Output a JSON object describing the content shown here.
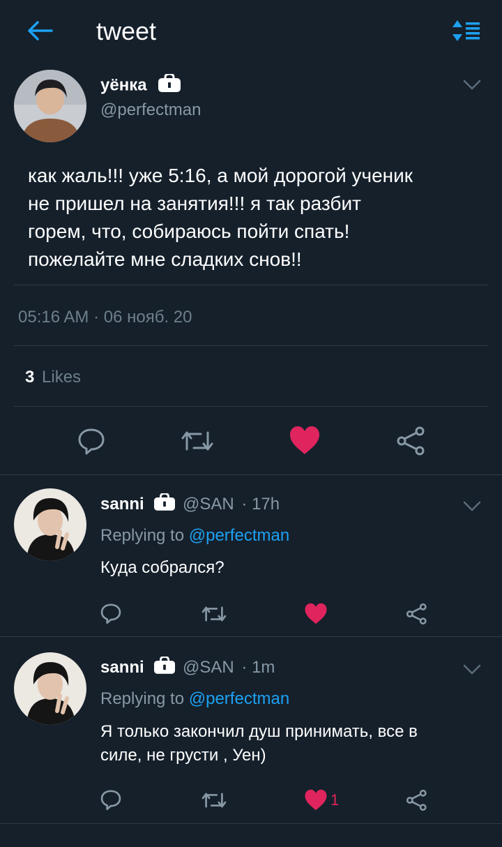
{
  "header": {
    "title": "tweet",
    "back_icon": "arrow-left-icon",
    "sort_icon": "sort-icon",
    "accent": "#1da1f2"
  },
  "main_tweet": {
    "display_name": "уёнка",
    "handle": "@perfectman",
    "text_lines": [
      "как жаль!!! уже 5:16, а мой дорогой ученик",
      "не пришел на занятия!!! я так разбит",
      "горем, что, собираюсь пойти спать!",
      "пожелайте мне сладких снов!!"
    ],
    "timestamp": "05:16 AM · 06 нояб. 20",
    "likes_count": "3",
    "likes_label": "Likes",
    "liked": true
  },
  "replies": [
    {
      "display_name": "sanni",
      "handle": "@SAN",
      "time": "· 17h",
      "replying_to_label": "Replying to",
      "replying_to_handle": "@perfectman",
      "text_lines": [
        "Куда собрался?"
      ],
      "liked": true,
      "like_count": ""
    },
    {
      "display_name": "sanni",
      "handle": "@SAN",
      "time": "· 1m",
      "replying_to_label": "Replying to",
      "replying_to_handle": "@perfectman",
      "text_lines": [
        "Я только закончил душ принимать, все в",
        "силе, не грусти , Уен)"
      ],
      "liked": true,
      "like_count": "1"
    }
  ],
  "colors": {
    "background": "#15202b",
    "like_red": "#e0245e",
    "muted": "#8899a6",
    "divider": "#2f3b47"
  }
}
